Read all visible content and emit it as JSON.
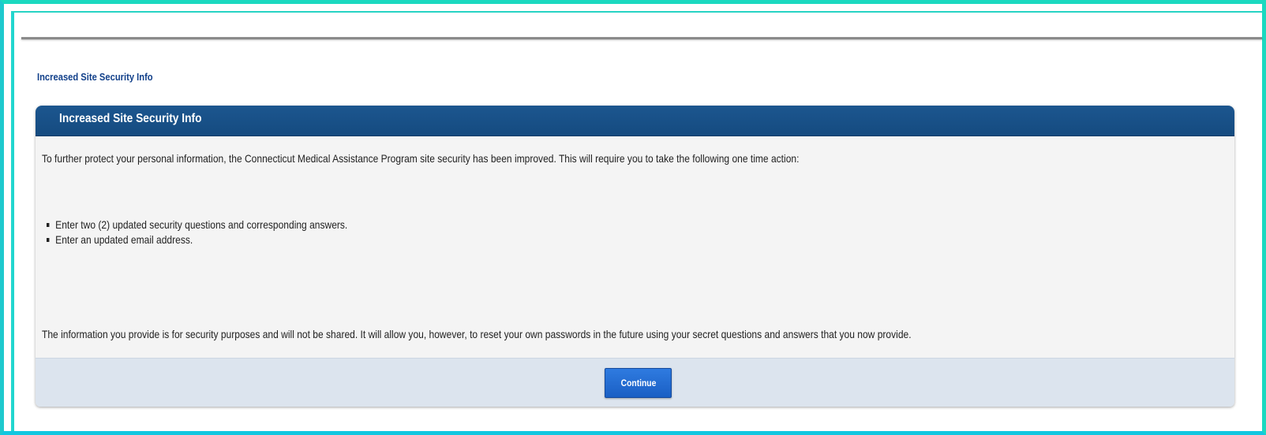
{
  "page": {
    "title": "Increased Site Security Info"
  },
  "panel": {
    "header_title": "Increased Site Security Info",
    "intro_text": "To further protect your personal information, the Connecticut Medical Assistance Program site security has been improved. This will require you to take the following one time action:",
    "bullets": [
      "Enter two (2) updated security questions and corresponding answers.",
      "Enter an updated email address."
    ],
    "footer_text": "The information you provide is for security purposes and will not be shared. It will allow you, however, to reset your own passwords in the future using your secret questions and answers that you now provide.",
    "continue_label": "Continue"
  },
  "colors": {
    "frame_border": "#1bd9c0",
    "header_background": "#1c568f",
    "page_title_text": "#12408a",
    "button_background": "#2f7be0",
    "footer_background": "#dce4ee",
    "body_background": "#f4f4f4"
  }
}
